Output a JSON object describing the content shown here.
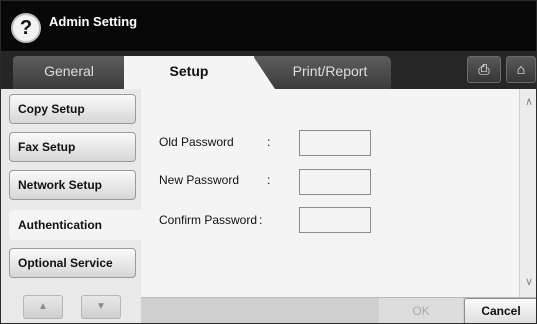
{
  "window": {
    "title": "Admin Setting",
    "help_icon": "?"
  },
  "tabs": [
    {
      "label": "General",
      "active": false
    },
    {
      "label": "Setup",
      "active": true
    },
    {
      "label": "Print/Report",
      "active": false
    }
  ],
  "toolbar": {
    "save_icon": "⎙",
    "home_icon": "⌂"
  },
  "menu": {
    "items": [
      {
        "label": "Copy Setup",
        "active": false
      },
      {
        "label": "Fax Setup",
        "active": false
      },
      {
        "label": "Network Setup",
        "active": false
      },
      {
        "label": "Authentication",
        "active": true
      },
      {
        "label": "Optional Service",
        "active": false
      }
    ],
    "up_icon": "▲",
    "down_icon": "▼"
  },
  "form": {
    "old_password": {
      "label": "Old Password",
      "colon": ":",
      "value": ""
    },
    "new_password": {
      "label": "New Password",
      "colon": ":",
      "value": ""
    },
    "confirm_password": {
      "label": "Confirm Password",
      "colon": ":",
      "value": ""
    }
  },
  "scrollbar": {
    "up_icon": "∧",
    "down_icon": "∨"
  },
  "actions": {
    "ok_label": "OK",
    "cancel_label": "Cancel",
    "ok_enabled": false
  }
}
